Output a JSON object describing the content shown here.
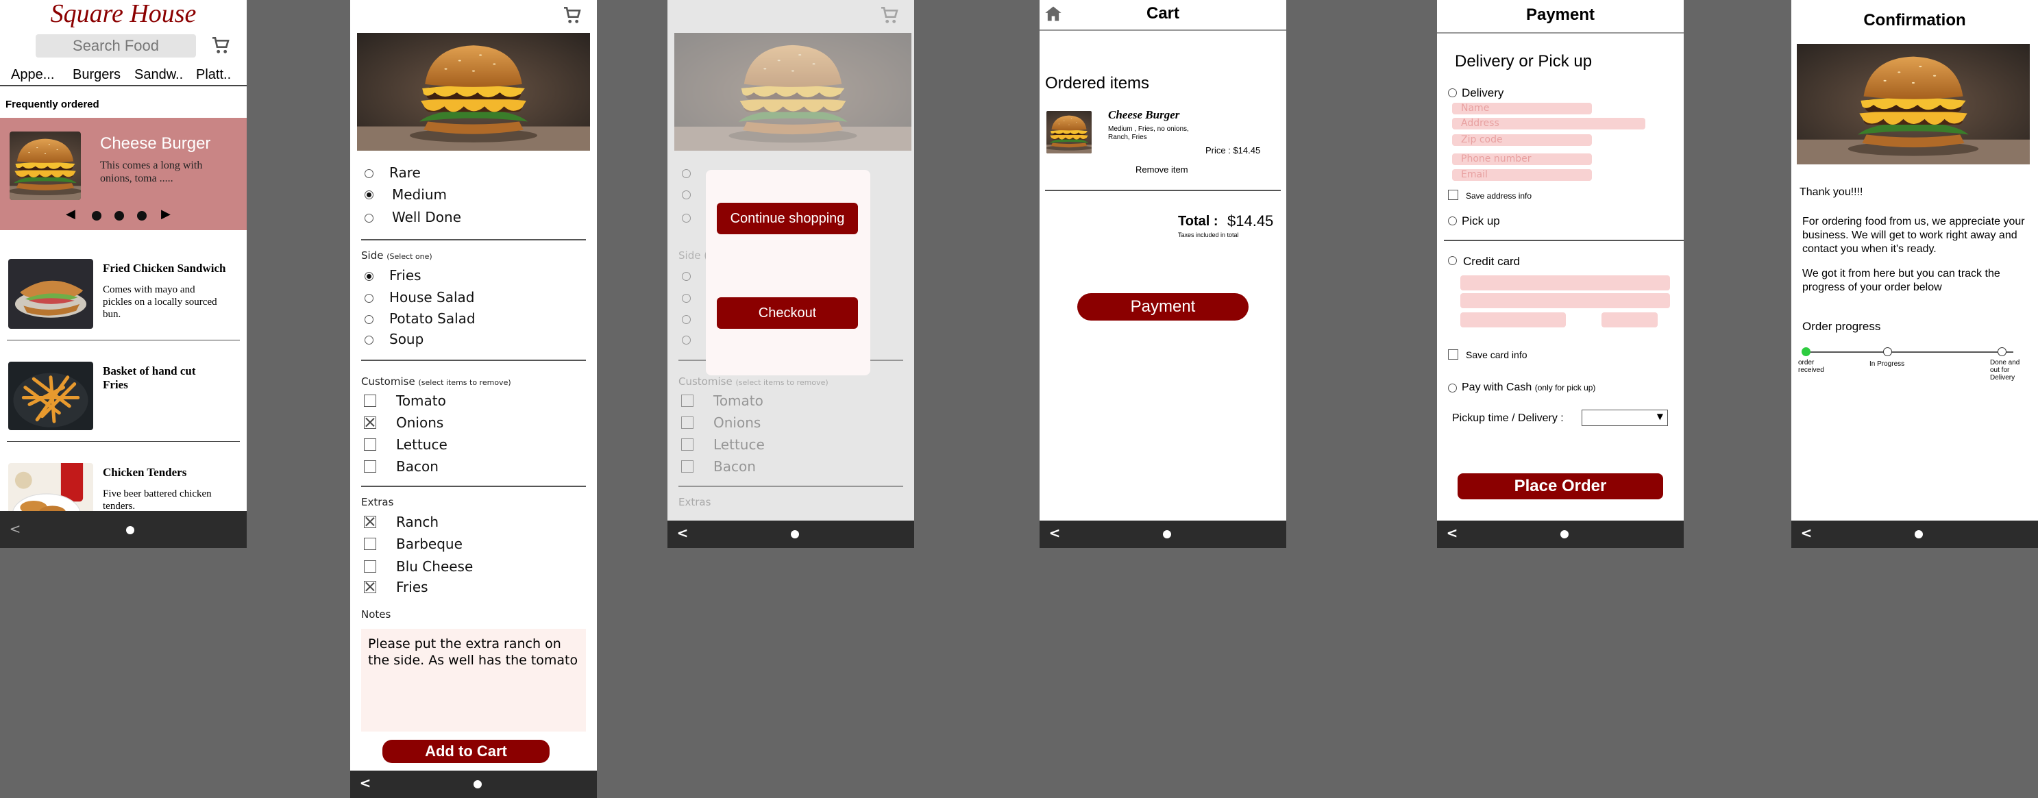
{
  "screen1": {
    "brand": "Square House",
    "search_placeholder": "Search Food",
    "categories": [
      "Appe...",
      "Burgers",
      "Sandw..",
      "Platt.."
    ],
    "section_title": "Frequently ordered",
    "featured": {
      "name": "Cheese Burger",
      "desc": "This comes a long with onions, toma ....."
    },
    "items": [
      {
        "name": "Fried Chicken Sandwich",
        "desc": "Comes with mayo and pickles on a locally sourced bun."
      },
      {
        "name": "Basket of hand cut Fries",
        "desc": ""
      },
      {
        "name": "Chicken Tenders",
        "desc": "Five beer battered chicken tenders."
      }
    ],
    "carousel_prev": "◀",
    "carousel_next": "▶"
  },
  "screen2": {
    "doneness": [
      {
        "label": "Rare",
        "selected": false
      },
      {
        "label": "Medium",
        "selected": true
      },
      {
        "label": "Well Done",
        "selected": false
      }
    ],
    "side_title": "Side",
    "side_hint": "(Select one)",
    "sides": [
      {
        "label": "Fries",
        "selected": true
      },
      {
        "label": "House Salad",
        "selected": false
      },
      {
        "label": "Potato Salad",
        "selected": false
      },
      {
        "label": "Soup",
        "selected": false
      }
    ],
    "customise_title": "Customise",
    "customise_hint": "(select items to remove)",
    "customise": [
      {
        "label": "Tomato",
        "checked": false
      },
      {
        "label": "Onions",
        "checked": true
      },
      {
        "label": "Lettuce",
        "checked": false
      },
      {
        "label": "Bacon",
        "checked": false
      }
    ],
    "extras_title": "Extras",
    "extras": [
      {
        "label": "Ranch",
        "checked": true
      },
      {
        "label": "Barbeque",
        "checked": false
      },
      {
        "label": "Blu Cheese",
        "checked": false
      },
      {
        "label": "Fries",
        "checked": true
      }
    ],
    "notes_title": "Notes",
    "notes_text": "Please put the extra ranch on the side. As well has the tomato",
    "add_to_cart": "Add to Cart"
  },
  "screen3": {
    "continue_label": "Continue shopping",
    "checkout_label": "Checkout",
    "side_partial": "Side (",
    "customise_title": "Customise",
    "customise_hint": "(select items to remove)",
    "customise": [
      "Tomato",
      "Onions",
      "Lettuce",
      "Bacon"
    ],
    "extras_title": "Extras"
  },
  "cart": {
    "title": "Cart",
    "section": "Ordered items",
    "item_name": "Cheese Burger",
    "item_desc": "Medium , Fries, no onions, Ranch, Fries",
    "price_label": "Price :  $14.45",
    "remove": "Remove item",
    "total_label": "Total :",
    "total_value": "$14.45",
    "taxes_note": "Taxes included in total",
    "payment_button": "Payment"
  },
  "payment": {
    "title": "Payment",
    "heading": "Delivery or Pick up",
    "delivery": "Delivery",
    "fields": [
      "Name",
      "Address",
      "Zip code",
      "Phone number",
      "Email"
    ],
    "save_address": "Save address info",
    "pickup": "Pick up",
    "credit": "Credit card",
    "save_card": "Save card info",
    "cash": "Pay with Cash",
    "cash_note": "(only for pick up)",
    "pickup_time_label": "Pickup time / Delivery :",
    "pickup_time_value": "",
    "place_order": "Place Order"
  },
  "confirmation": {
    "title": "Confirmation",
    "thanks": "Thank you!!!!",
    "para1": "For ordering food from us, we appreciate your  business. We will get to work right away and contact you when it's ready.",
    "para2": "We got it from here but  you can track the progress of your order below",
    "progress_title": "Order progress",
    "steps": [
      "order received",
      "In Progress",
      "Done and out for Delivery"
    ],
    "progress_fraction": 0.0
  },
  "colors": {
    "accent": "#8b0000",
    "featured_bg": "#c98585",
    "field_bg": "#f8d2d2",
    "progress_done": "#2ecc40"
  },
  "icons": [
    "cart-icon",
    "home-icon",
    "back-icon",
    "home-dot-icon",
    "chevron-down-icon"
  ]
}
